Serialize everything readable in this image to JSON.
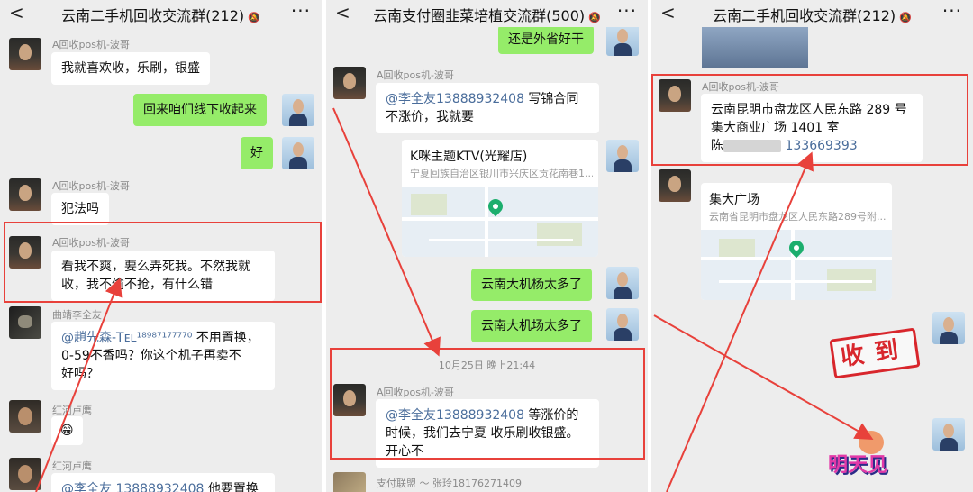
{
  "panels": [
    {
      "header": {
        "back": "<",
        "title": "云南二手机回收交流群(212)",
        "mute": "🔕",
        "more": "···"
      },
      "messages": [
        {
          "name": "A回收pos机-波哥",
          "text": "我就喜欢收，乐刷，银盛"
        },
        {
          "text": "回来咱们线下收起来"
        },
        {
          "text": "好"
        },
        {
          "name": "A回收pos机-波哥",
          "text": "犯法吗"
        },
        {
          "name": "A回收pos机-波哥",
          "line1": "看我不爽，要么弄死我。不然我就",
          "line2": "收，我不偷不抢，有什么错"
        },
        {
          "name": "曲靖李全友",
          "mention": "@趙先森-Tᴇʟ¹⁸⁹⁸⁷¹⁷⁷⁷⁷⁰",
          "rest": " 不用置换，",
          "line2": "0-59不香吗？你这个机子再卖不",
          "line3": "好吗？"
        },
        {
          "name": "红河卢鹰",
          "text": "😁"
        },
        {
          "name": "红河卢鹰",
          "mention": "@李全友",
          "phone": "13888932408",
          "rest": " 他要置换"
        }
      ]
    },
    {
      "header": {
        "back": "<",
        "title": "云南支付圈韭菜培植交流群(500)",
        "mute": "🔕",
        "more": "···"
      },
      "messages": [
        {
          "text": "还是外省好干"
        },
        {
          "name": "A回收pos机-波哥",
          "mention": "@李全友",
          "phone": "13888932408",
          "rest": " 写锦合同",
          "line2": "不涨价，我就要"
        },
        {
          "title": "K咪主题KTV(光耀店)",
          "sub": "宁夏回族自治区银川市兴庆区贡花南巷1..."
        },
        {
          "text": "云南大机杨太多了"
        },
        {
          "text": "云南大机场太多了"
        },
        {
          "timestamp": "10月25日 晚上21:44"
        },
        {
          "name": "A回收pos机-波哥",
          "mention": "@李全友",
          "phone": "13888932408",
          "rest": " 等涨价的",
          "line2": "时候，我们去宁夏 收乐刷收银盛。",
          "line3": "开心不"
        },
        {
          "name": "支付联盟 ～ 张玲18176271409"
        }
      ]
    },
    {
      "header": {
        "back": "<",
        "title": "云南二手机回收交流群(212)",
        "mute": "🔕",
        "more": "···"
      },
      "messages": [
        {
          "name": "A回收pos机-波哥",
          "line1": "云南昆明市盘龙区人民东路 289 号",
          "line2": "集大商业广场 1401 室",
          "line3_prefix": "陈",
          "line3_phone": "13",
          "line3_phone_b": "3669393"
        },
        {
          "title": "集大广场",
          "sub": "云南省昆明市盘龙区人民东路289号附..."
        },
        {
          "stamp": "收到"
        },
        {
          "sticker": "明天见"
        }
      ]
    }
  ],
  "colors": {
    "accent_red": "#e8413b",
    "green_bubble": "#95ec69",
    "link": "#4a6d9b"
  }
}
